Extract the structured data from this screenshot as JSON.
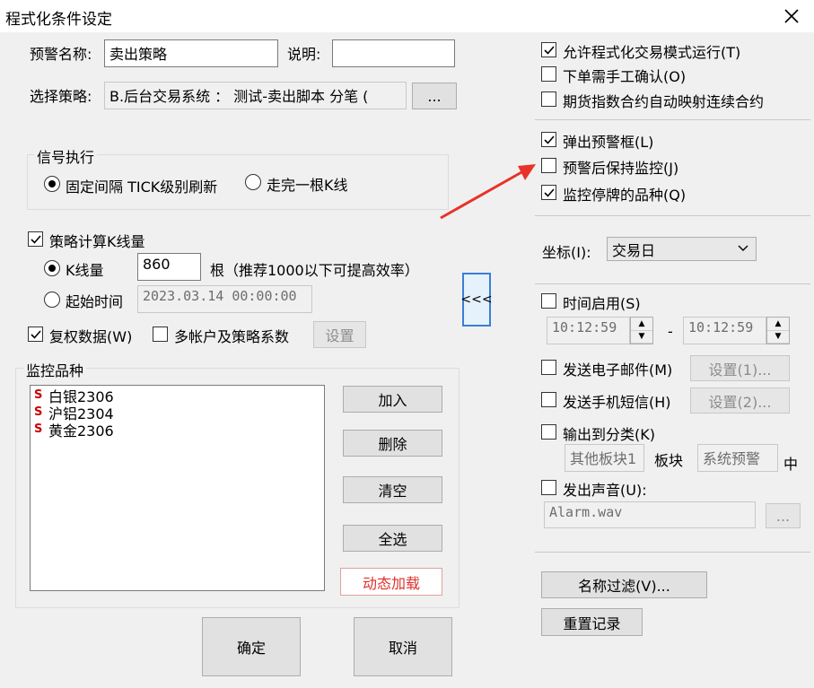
{
  "window": {
    "title": "程式化条件设定"
  },
  "left": {
    "alert_name_label": "预警名称:",
    "alert_name_value": "卖出策略",
    "desc_label": "说明:",
    "desc_value": "",
    "strategy_label": "选择策略:",
    "strategy_value": "B.后台交易系统 ： 测试-卖出脚本 分笔 (",
    "browse_label": "...",
    "signal_group_title": "信号执行",
    "signal_options": {
      "fixed_interval": "固定间隔 TICK级别刷新",
      "complete_bar": "走完一根K线"
    },
    "calc_bars_label": "策略计算K线量",
    "bar_count_label": "K线量",
    "bar_count_value": "860",
    "bar_count_hint": "根（推荐1000以下可提高效率）",
    "start_time_label": "起始时间",
    "start_time_value": "2023.03.14 00:00:00",
    "adjusted_data_label": "复权数据(W)",
    "multi_account_label": "多帐户及策略系数",
    "settings_label": "设置",
    "monitor_group_title": "监控品种",
    "monitor_items": [
      {
        "tag": "S",
        "name": "白银2306"
      },
      {
        "tag": "S",
        "name": "沪铝2304"
      },
      {
        "tag": "S",
        "name": "黄金2306"
      }
    ],
    "add_label": "加入",
    "delete_label": "删除",
    "clear_label": "清空",
    "select_all_label": "全选",
    "dynamic_load_label": "动态加载",
    "ok_label": "确定",
    "cancel_label": "取消",
    "collapse_label": "<<<"
  },
  "right": {
    "allow_auto_trade": "允许程式化交易模式运行(T)",
    "manual_confirm": "下单需手工确认(O)",
    "futures_map": "期货指数合约自动映射连续合约",
    "popup_alert": "弹出预警框(L)",
    "keep_monitor": "预警后保持监控(J)",
    "monitor_suspended": "监控停牌的品种(Q)",
    "coord_label": "坐标(I):",
    "coord_value": "交易日",
    "time_enable": "时间启用(S)",
    "time_start": "10:12:59",
    "time_dash": "-",
    "time_end": "10:12:59",
    "send_email": "发送电子邮件(M)",
    "email_settings": "设置(1)...",
    "send_sms": "发送手机短信(H)",
    "sms_settings": "设置(2)...",
    "output_category": "输出到分类(K)",
    "category_value": "其他板块1",
    "category_mid": "板块",
    "category_value2": "系统预警",
    "category_suffix": "中",
    "play_sound": "发出声音(U):",
    "sound_file": "Alarm.wav",
    "sound_browse": "...",
    "name_filter": "名称过滤(V)...",
    "reset_records": "重置记录"
  },
  "checks": {
    "allow_auto_trade": true,
    "manual_confirm": false,
    "futures_map": false,
    "popup_alert": true,
    "keep_monitor": false,
    "monitor_suspended": true,
    "calc_bars": true,
    "adjusted_data": true,
    "multi_account": false,
    "time_enable": false,
    "send_email": false,
    "send_sms": false,
    "output_category": false,
    "play_sound": false
  },
  "colors": {
    "arrow": "#e8322a",
    "collapse_border": "#3a7fd5",
    "tag": "#cc0000"
  }
}
